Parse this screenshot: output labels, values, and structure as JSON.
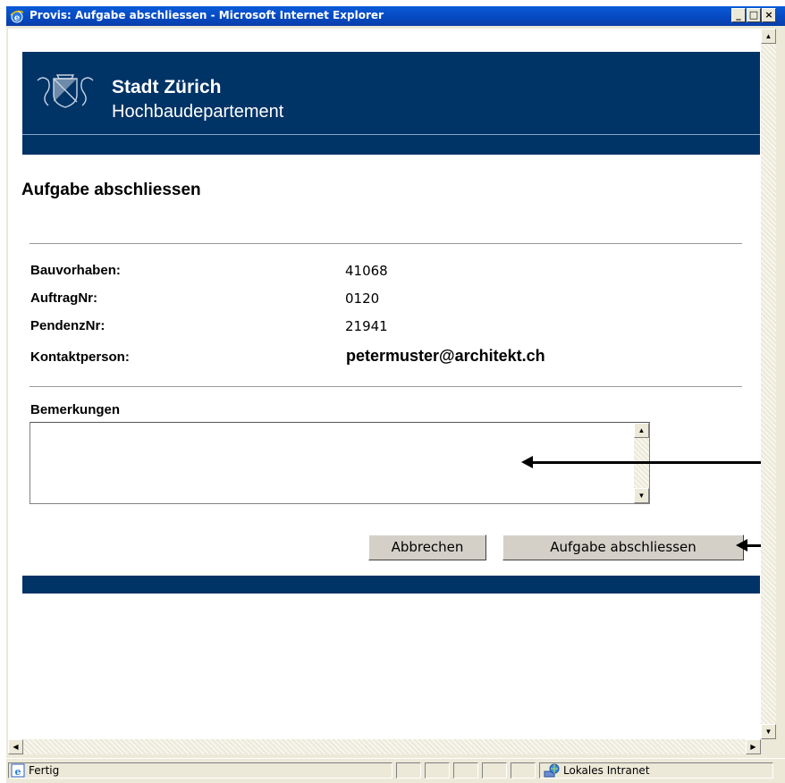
{
  "window": {
    "title": "Provis: Aufgabe abschliessen - Microsoft Internet Explorer",
    "minimize": "_",
    "maximize": "□",
    "close": "×"
  },
  "banner": {
    "title": "Stadt Zürich",
    "subtitle": "Hochbaudepartement"
  },
  "page": {
    "heading": "Aufgabe abschliessen"
  },
  "fields": {
    "bauvorhaben_label": "Bauvorhaben:",
    "bauvorhaben_value": "41068",
    "auftragnr_label": "AuftragNr:",
    "auftragnr_value": "0120",
    "pendenznr_label": "PendenzNr:",
    "pendenznr_value": "21941",
    "kontakt_label": "Kontaktperson:",
    "kontakt_value": "petermuster@architekt.ch"
  },
  "remarks": {
    "label": "Bemerkungen",
    "value": ""
  },
  "buttons": {
    "cancel": "Abbrechen",
    "submit": "Aufgabe abschliessen"
  },
  "statusbar": {
    "status": "Fertig",
    "zone": "Lokales Intranet"
  },
  "icons": {
    "app": "ie-icon",
    "zone": "intranet-globe-icon",
    "crest": "zurich-crest-icon"
  },
  "colors": {
    "banner": "#003366",
    "titlebar": "#0648c0"
  }
}
